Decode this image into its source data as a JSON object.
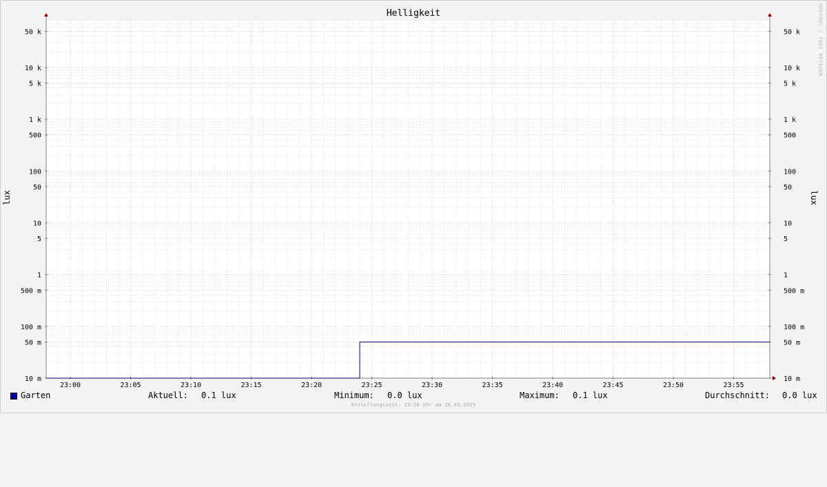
{
  "chart_data": {
    "type": "line",
    "title": "Helligkeit",
    "ylabel": "lux",
    "yscale": "log",
    "ylim": [
      0.01,
      80000
    ],
    "xlim": [
      "22:58",
      "23:58"
    ],
    "x_ticks": [
      "23:00",
      "23:05",
      "23:10",
      "23:15",
      "23:20",
      "23:25",
      "23:30",
      "23:35",
      "23:40",
      "23:45",
      "23:50",
      "23:55"
    ],
    "y_ticks": [
      {
        "value": 0.01,
        "label": "10 m"
      },
      {
        "value": 0.05,
        "label": "50 m"
      },
      {
        "value": 0.1,
        "label": "100 m"
      },
      {
        "value": 0.5,
        "label": "500 m"
      },
      {
        "value": 1,
        "label": "1"
      },
      {
        "value": 5,
        "label": "5"
      },
      {
        "value": 10,
        "label": "10"
      },
      {
        "value": 50,
        "label": "50"
      },
      {
        "value": 100,
        "label": "100"
      },
      {
        "value": 500,
        "label": "500"
      },
      {
        "value": 1000,
        "label": "1 k"
      },
      {
        "value": 5000,
        "label": "5 k"
      },
      {
        "value": 10000,
        "label": "10 k"
      },
      {
        "value": 50000,
        "label": "50 k"
      }
    ],
    "series": [
      {
        "name": "Garten",
        "color": "#000080",
        "points": [
          {
            "x": "22:58",
            "y": 0.01
          },
          {
            "x": "23:24",
            "y": 0.01
          },
          {
            "x": "23:24",
            "y": 0.05
          },
          {
            "x": "23:58",
            "y": 0.05
          }
        ]
      }
    ],
    "grid": true,
    "colors": {
      "major_grid": "#e8a0a0",
      "minor_grid": "#c8c8c8",
      "axis": "#7f7f7f",
      "arrow": "#8b0000"
    }
  },
  "legend": {
    "series_name": "Garten",
    "current_label": "Aktuell:",
    "current_value": "0.1 lux",
    "min_label": "Minimum:",
    "min_value": "0.0 lux",
    "max_label": "Maximum:",
    "max_value": "0.1 lux",
    "avg_label": "Durchschnitt:",
    "avg_value": "0.0 lux"
  },
  "footer": "Erstellungszeit: 23:58 Uhr am 28.03.2025",
  "watermark": "RRDTOOL / TOBI OETIKER"
}
